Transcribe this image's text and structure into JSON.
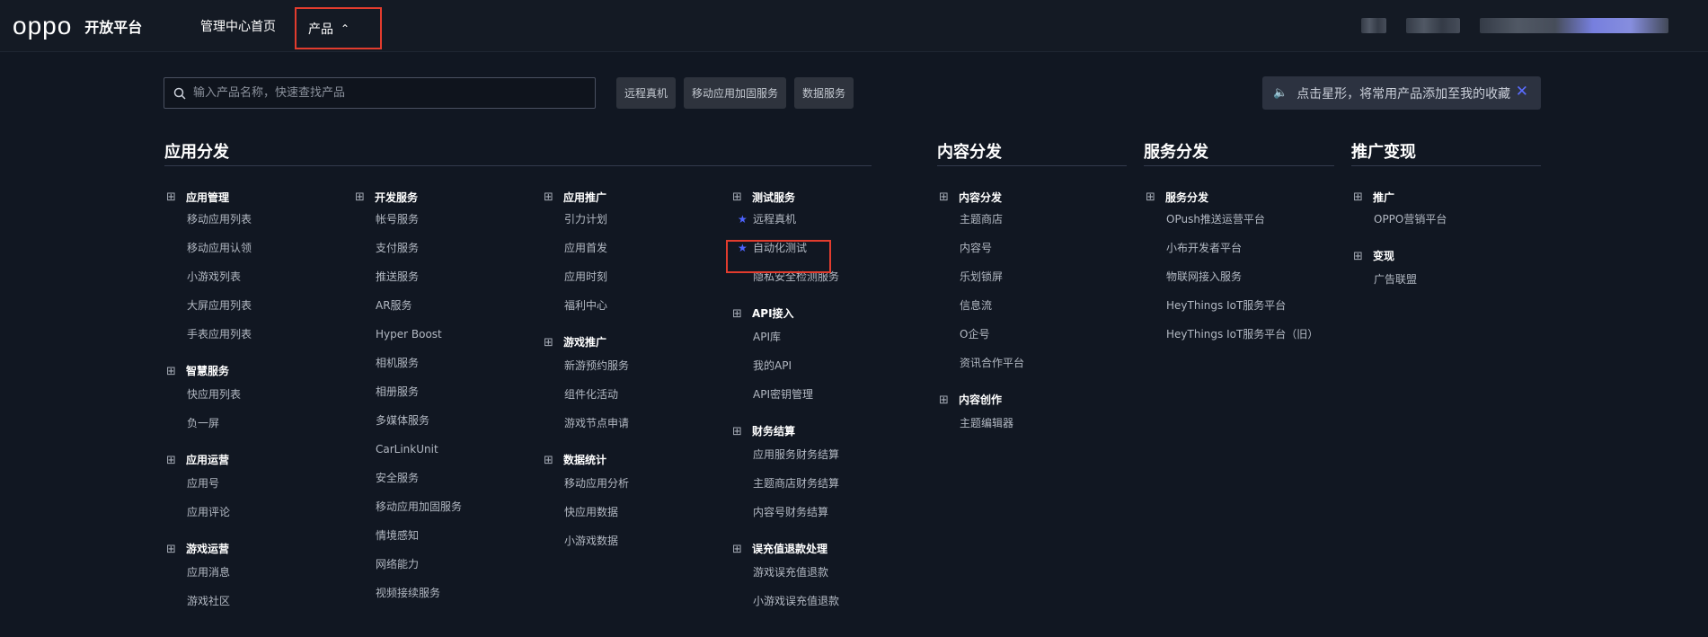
{
  "header": {
    "logo": "oppo",
    "platform": "开放平台",
    "nav_home": "管理中心首页",
    "nav_product": "产品"
  },
  "search": {
    "placeholder": "输入产品名称，快速查找产品"
  },
  "quick_chips": [
    "远程真机",
    "移动应用加固服务",
    "数据服务"
  ],
  "notice": {
    "text": "点击星形，将常用产品添加至我的收藏"
  },
  "categories": {
    "app": "应用分发",
    "content": "内容分发",
    "service": "服务分发",
    "promo": "推广变现"
  },
  "columns": {
    "c1": {
      "g1": "应用管理",
      "g1_items": [
        "移动应用列表",
        "移动应用认领",
        "小游戏列表",
        "大屏应用列表",
        "手表应用列表"
      ],
      "g2": "智慧服务",
      "g2_items": [
        "快应用列表",
        "负一屏"
      ],
      "g3": "应用运营",
      "g3_items": [
        "应用号",
        "应用评论"
      ],
      "g4": "游戏运营",
      "g4_items": [
        "应用消息",
        "游戏社区"
      ]
    },
    "c2": {
      "g1": "开发服务",
      "g1_items": [
        "帐号服务",
        "支付服务",
        "推送服务",
        "AR服务",
        "Hyper Boost",
        "相机服务",
        "相册服务",
        "多媒体服务",
        "CarLinkUnit",
        "安全服务",
        "移动应用加固服务",
        "情境感知",
        "网络能力",
        "视频接续服务"
      ]
    },
    "c3": {
      "g1": "应用推广",
      "g1_items": [
        "引力计划",
        "应用首发",
        "应用时刻",
        "福利中心"
      ],
      "g2": "游戏推广",
      "g2_items": [
        "新游预约服务",
        "组件化活动",
        "游戏节点申请"
      ],
      "g3": "数据统计",
      "g3_items": [
        "移动应用分析",
        "快应用数据",
        "小游戏数据"
      ]
    },
    "c4": {
      "g1": "测试服务",
      "g1_items": [
        "远程真机",
        "自动化测试",
        "隐私安全检测服务"
      ],
      "g2": "API接入",
      "g2_items": [
        "API库",
        "我的API",
        "API密钥管理"
      ],
      "g3": "财务结算",
      "g3_items": [
        "应用服务财务结算",
        "主题商店财务结算",
        "内容号财务结算"
      ],
      "g4": "误充值退款处理",
      "g4_items": [
        "游戏误充值退款",
        "小游戏误充值退款"
      ]
    },
    "c5": {
      "g1": "内容分发",
      "g1_items": [
        "主题商店",
        "内容号",
        "乐划锁屏",
        "信息流",
        "O企号",
        "资讯合作平台"
      ],
      "g2": "内容创作",
      "g2_items": [
        "主题编辑器"
      ]
    },
    "c6": {
      "g1": "服务分发",
      "g1_items": [
        "OPush推送运营平台",
        "小布开发者平台",
        "物联网接入服务",
        "HeyThings IoT服务平台",
        "HeyThings IoT服务平台（旧）"
      ]
    },
    "c7": {
      "g1": "推广",
      "g1_items": [
        "OPPO营销平台"
      ],
      "g2": "变现",
      "g2_items": [
        "广告联盟"
      ]
    }
  },
  "icons": {
    "group": "grid-icon",
    "favorite": "star-icon",
    "search": "search-icon",
    "speaker": "speaker-icon",
    "close": "close-icon"
  },
  "colors": {
    "accent": "#4d63ff",
    "highlight_border": "#e23c2e",
    "background": "#111722"
  }
}
